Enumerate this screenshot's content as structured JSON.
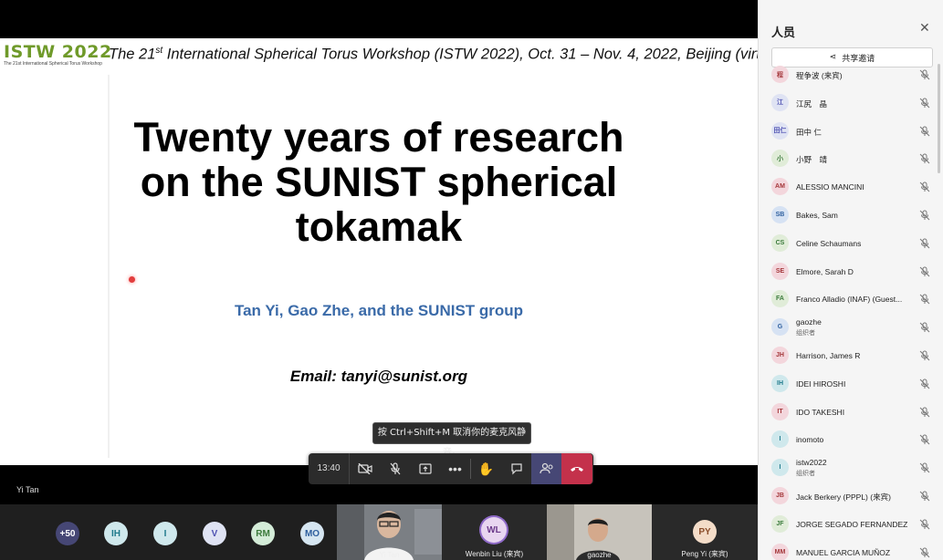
{
  "slide": {
    "logo_text": "ISTW 2022",
    "logo_subtext": "The 21st International Spherical Torus Workshop",
    "header_pre": "The 21",
    "header_sup": "st",
    "header_post": " International Spherical Torus Workshop (ISTW 2022), Oct. 31 – Nov. 4, 2022, Beijing (virtual)",
    "title_line1": "Twenty years of research",
    "title_line2": "on the SUNIST spherical",
    "title_line3": "tokamak",
    "authors": "Tan Yi, Gao Zhe, and the SUNIST group",
    "email": "Email: tanyi@sunist.org"
  },
  "tooltip": "按 Ctrl+Shift+M 取消你的麦克风静音。",
  "controls": {
    "timer": "13:40",
    "buttons": [
      "camera-off-icon",
      "mic-off-icon",
      "share-screen-icon",
      "more-icon",
      "raise-hand-icon",
      "chat-icon",
      "participants-icon",
      "hangup-icon"
    ]
  },
  "presenter_name": "Yi Tan",
  "strip": {
    "overflow": "+50",
    "avatars": [
      {
        "initials": "IH",
        "color": "#cfe8ec"
      },
      {
        "initials": "I",
        "color": "#cfe8ec"
      },
      {
        "initials": "V",
        "color": "#dfe3f3"
      },
      {
        "initials": "RM",
        "color": "#d4ecd8"
      },
      {
        "initials": "MO",
        "color": "#d6e6f1"
      }
    ],
    "tiles": [
      {
        "name": "Yi Tan"
      },
      {
        "name": "Wenbin Liu (来宾)",
        "initials": "WL"
      },
      {
        "name": "gaozhe"
      },
      {
        "name": "Peng Yi (来宾)",
        "initials": "PY"
      }
    ]
  },
  "panel": {
    "title": "人员",
    "share_label": "共享邀请",
    "participants": [
      {
        "initials": "程",
        "name": "程争波 (来宾)",
        "color": "#f3d6dc",
        "fg": "#a4373a"
      },
      {
        "initials": "江",
        "name": "江尻　晶",
        "color": "#dfe3f3",
        "fg": "#4f52b2"
      },
      {
        "initials": "田仁",
        "name": "田中 仁",
        "color": "#dfe3f3",
        "fg": "#4f52b2"
      },
      {
        "initials": "小",
        "name": "小野　靖",
        "color": "#e0ecd8",
        "fg": "#3b7a3b"
      },
      {
        "initials": "AM",
        "name": "ALESSIO MANCINI",
        "color": "#f3d6dc",
        "fg": "#a4373a"
      },
      {
        "initials": "SB",
        "name": "Bakes, Sam",
        "color": "#d6e2f3",
        "fg": "#2e5f9e"
      },
      {
        "initials": "CS",
        "name": "Celine Schaumans",
        "color": "#e0ecd8",
        "fg": "#3b7a3b"
      },
      {
        "initials": "SE",
        "name": "Elmore, Sarah D",
        "color": "#f3d6dc",
        "fg": "#a4373a"
      },
      {
        "initials": "FA",
        "name": "Franco Alladio (INAF) (Guest...",
        "color": "#e0ecd8",
        "fg": "#3b7a3b"
      },
      {
        "initials": "G",
        "name": "gaozhe",
        "role": "组织者",
        "color": "#d6e2f3",
        "fg": "#2e5f9e"
      },
      {
        "initials": "JH",
        "name": "Harrison, James R",
        "color": "#f3d6dc",
        "fg": "#a4373a"
      },
      {
        "initials": "IH",
        "name": "IDEI HIROSHI",
        "color": "#cfe8ec",
        "fg": "#1f7a8c"
      },
      {
        "initials": "IT",
        "name": "IDO TAKESHI",
        "color": "#f3d6dc",
        "fg": "#a4373a"
      },
      {
        "initials": "I",
        "name": "inomoto",
        "color": "#cfe8ec",
        "fg": "#1f7a8c"
      },
      {
        "initials": "I",
        "name": "istw2022",
        "role": "组织者",
        "color": "#cfe8ec",
        "fg": "#1f7a8c"
      },
      {
        "initials": "JB",
        "name": "Jack Berkery (PPPL) (来宾)",
        "color": "#f3d6dc",
        "fg": "#a4373a"
      },
      {
        "initials": "JF",
        "name": "JORGE SEGADO FERNANDEZ",
        "color": "#e0ecd8",
        "fg": "#3b7a3b"
      },
      {
        "initials": "MM",
        "name": "MANUEL GARCIA MUÑOZ",
        "color": "#f3d6dc",
        "fg": "#a4373a"
      }
    ]
  }
}
